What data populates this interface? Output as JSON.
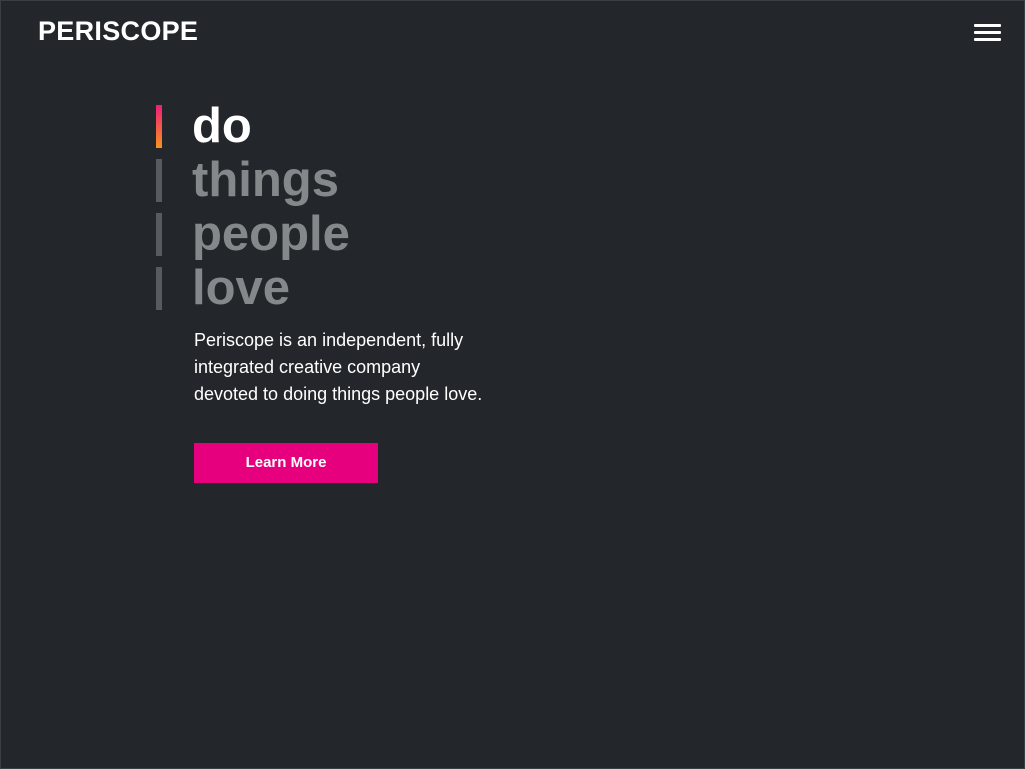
{
  "header": {
    "logo": "PERISCOPE",
    "menu_icon": "hamburger-menu-icon"
  },
  "hero": {
    "words": [
      {
        "text": "do",
        "active": true
      },
      {
        "text": "things",
        "active": false
      },
      {
        "text": "people",
        "active": false
      },
      {
        "text": "love",
        "active": false
      }
    ],
    "description": "Periscope is an independent, fully integrated creative company devoted to doing things people love.",
    "cta_label": "Learn More"
  },
  "colors": {
    "background": "#23272b",
    "accent": "#e6007e",
    "active_bar_gradient": [
      "#ed1e79",
      "#f7931e"
    ],
    "inactive_word": "#85888b",
    "inactive_bar": "#575b60",
    "text": "#ffffff"
  }
}
